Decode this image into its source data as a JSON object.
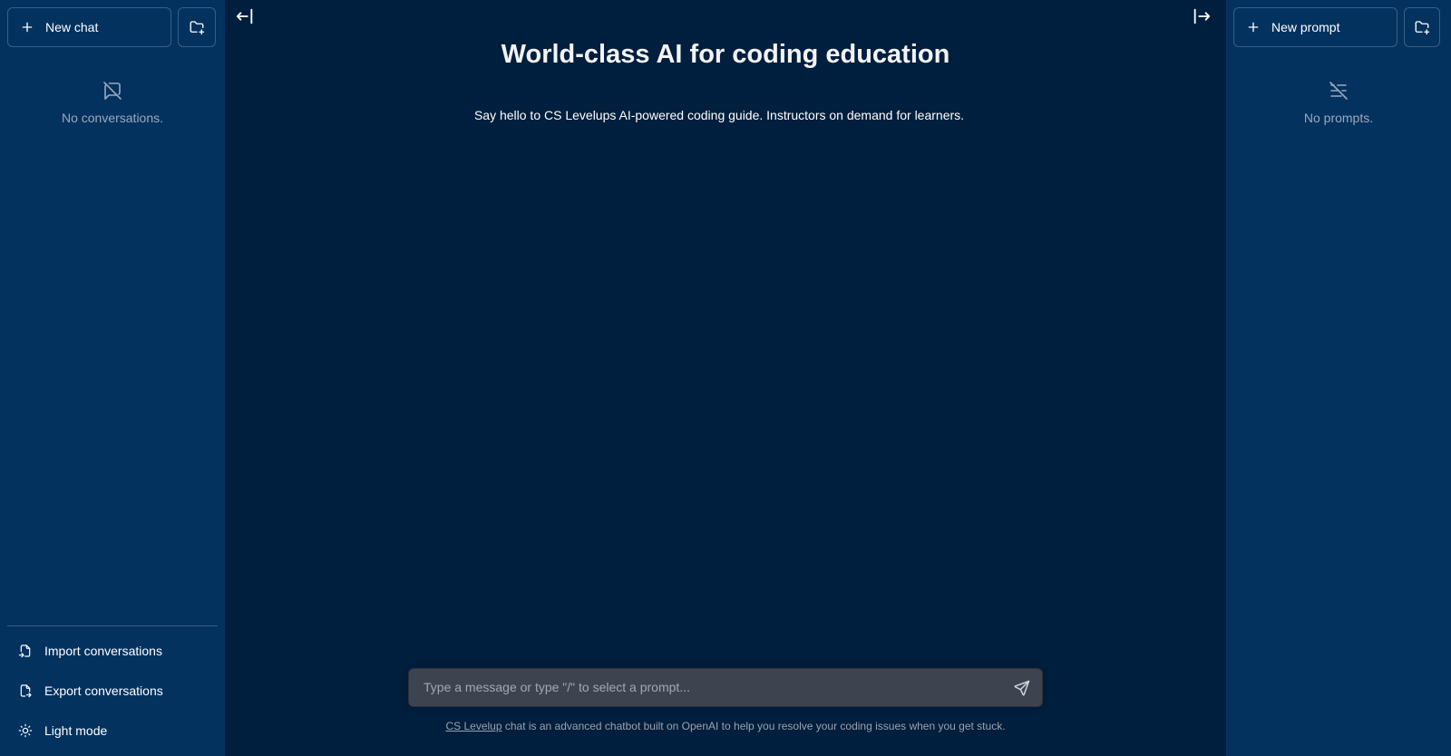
{
  "left_sidebar": {
    "new_chat_label": "New chat",
    "empty_text": "No conversations.",
    "bottom": {
      "import_label": "Import conversations",
      "export_label": "Export conversations",
      "theme_label": "Light mode"
    }
  },
  "main": {
    "title": "World-class AI for coding education",
    "subtitle": "Say hello to CS Levelups AI-powered coding guide. Instructors on demand for learners.",
    "input_placeholder": "Type a message or type \"/\" to select a prompt...",
    "footer_link": "CS Levelup",
    "footer_text": " chat is an advanced chatbot built on OpenAI to help you resolve your coding issues when you get stuck."
  },
  "right_sidebar": {
    "new_prompt_label": "New prompt",
    "empty_text": "No prompts."
  },
  "icons": {
    "plus": "plus-icon",
    "folder_plus": "folder-plus-icon",
    "no_messages": "message-off-icon",
    "no_prompts": "list-off-icon",
    "file_import": "file-import-icon",
    "file_export": "file-export-icon",
    "sun": "sun-icon",
    "collapse_left": "arrow-bar-left-icon",
    "collapse_right": "arrow-bar-right-icon",
    "send": "send-icon"
  },
  "colors": {
    "sidebar_bg": "#03325f",
    "main_bg": "#001e3d",
    "input_bg": "#3e4350"
  }
}
